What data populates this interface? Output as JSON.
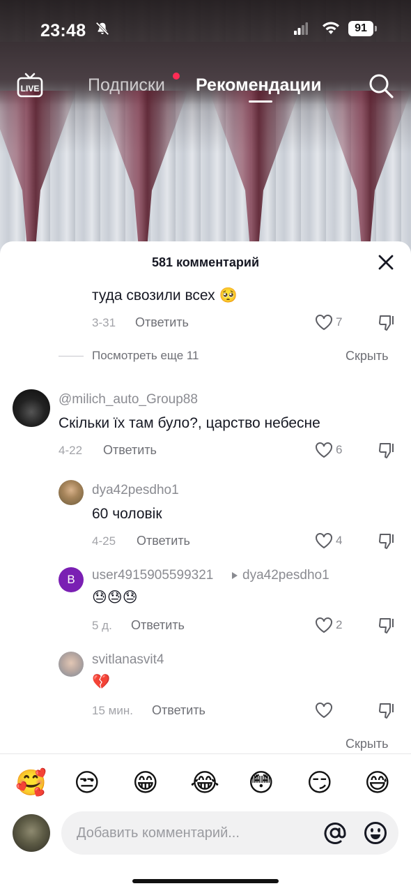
{
  "status_bar": {
    "time": "23:48",
    "battery": "91"
  },
  "top_nav": {
    "live_label": "LIVE",
    "tab_following": "Подписки",
    "tab_for_you": "Рекомендации"
  },
  "comments_sheet": {
    "header": "581 комментарий",
    "reply_label": "Ответить",
    "comments": [
      {
        "text": "туда свозили всех",
        "emoji": "🥺",
        "date": "3-31",
        "likes": "7"
      },
      {
        "username": "@milich_auto_Group88",
        "text": "Скільки їх там було?, царство небесне",
        "date": "4-22",
        "likes": "6"
      },
      {
        "username": "dya42pesdho1",
        "text": "60 чоловік",
        "date": "4-25",
        "likes": "4"
      },
      {
        "username": "user4915905599321",
        "reply_to": "dya42pesdho1",
        "avatar_letter": "B",
        "text": "😓😓😓",
        "date": "5 д.",
        "likes": "2"
      },
      {
        "username": "svitlanasvit4",
        "text": "💔",
        "date": "15 мин.",
        "likes": ""
      }
    ],
    "view_more": "Посмотреть еще 11",
    "hide_label": "Скрыть"
  },
  "emoji_bar": [
    "🥰",
    "😒",
    "😁",
    "😂",
    "😳",
    "😏",
    "😅"
  ],
  "input": {
    "placeholder": "Добавить комментарий..."
  },
  "colors": {
    "accent_dot": "#fe2c55",
    "avatar_b": "#7a1fb3"
  }
}
